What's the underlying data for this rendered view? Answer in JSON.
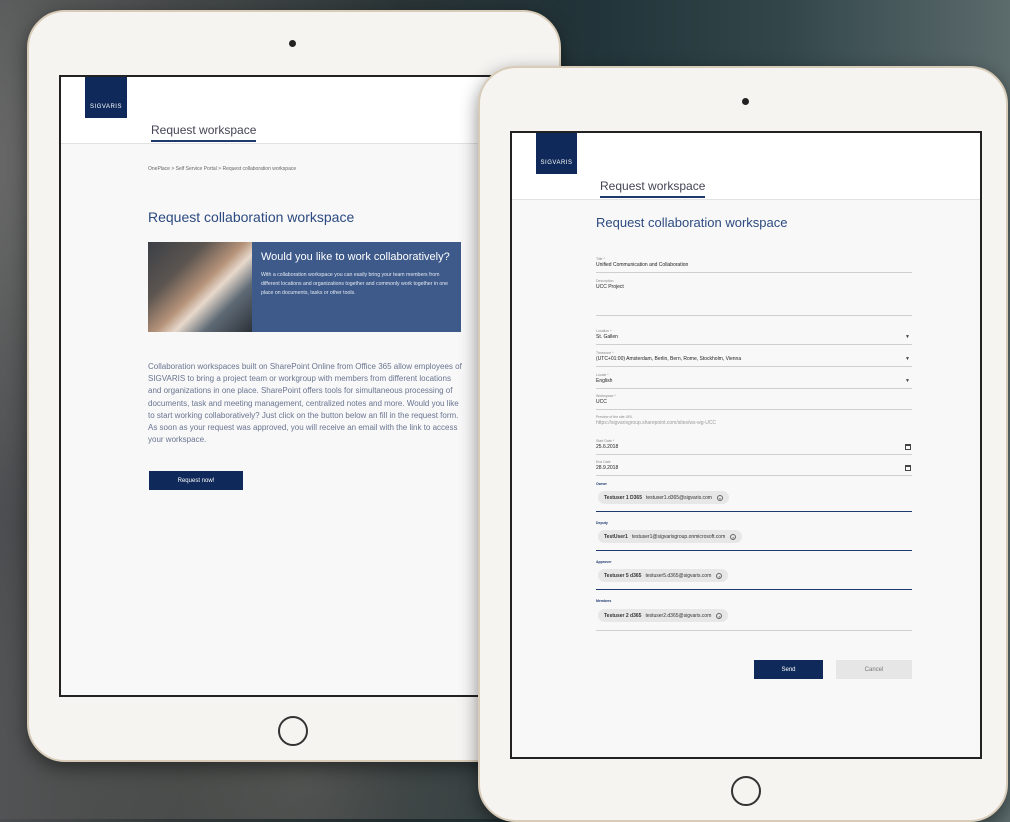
{
  "left_screen": {
    "logo": "SIGVARIS",
    "tab": "Request workspace",
    "breadcrumb": "OnePlace > Self Service Portal > Request collaboration workspace",
    "title": "Request collaboration workspace",
    "banner_title": "Would you like to work collaboratively?",
    "banner_text": "With a collaboration workspace you can easily bring your team members from different locations and organizations together and commonly work together in one place on documents, tasks or other tools.",
    "body": "Collaboration workspaces built on SharePoint Online from Office 365 allow employees of SIGVARIS to bring a project team or workgroup with members from different locations and organizations in one place. SharePoint offers tools for simultaneous processing of documents, task and meeting management, centralized notes and more. Would you like to start working collaboratively? Just click on the button below an fill in the request form. As soon as your request was approved, you will receive an email with the link to access your workspace.",
    "request_button": "Request now!"
  },
  "right_screen": {
    "logo": "SIGVARIS",
    "tab": "Request workspace",
    "title": "Request collaboration workspace",
    "form": {
      "title_label": "Title *",
      "title_value": "Unified Communication and Collaboration",
      "description_label": "Description",
      "description_value": "UCC Project",
      "location_label": "Location *",
      "location_value": "St. Gallen",
      "timezone_label": "Timezone *",
      "timezone_value": "(UTC+01:00) Amsterdam, Berlin, Bern, Rome, Stockholm, Vienna",
      "locale_label": "Locale *",
      "locale_value": "English",
      "workspace_label": "Workspace *",
      "workspace_value": "UCC",
      "preview_label": "Preview of the site URL",
      "preview_value": "https://sigvarisgroup.sharepoint.com/sites/ws-wg-UCC",
      "start_label": "Start Date *",
      "start_value": "25.6.2018",
      "end_label": "End Date",
      "end_value": "28.9.2018",
      "owner_label": "Owner",
      "owner_name": "Testuser 1 D365",
      "owner_email": "testuser1.d365@sigvaris.com",
      "deputy_label": "Deputy",
      "deputy_name": "TestUser1",
      "deputy_email": "testuser1@sigvarisgroup.onmicrosoft.com",
      "approver_label": "Approver",
      "approver_name": "Testuser 5 d365",
      "approver_email": "testuser5.d365@sigvaris.com",
      "members_label": "Members",
      "members_name": "Testuser 2 d365",
      "members_email": "testuser2.d365@sigvaris.com"
    },
    "send_button": "Send",
    "cancel_button": "Cancel"
  },
  "colors": {
    "brand": "#0f2a5a",
    "accent": "#3d5a8a",
    "title": "#2c4a80"
  }
}
